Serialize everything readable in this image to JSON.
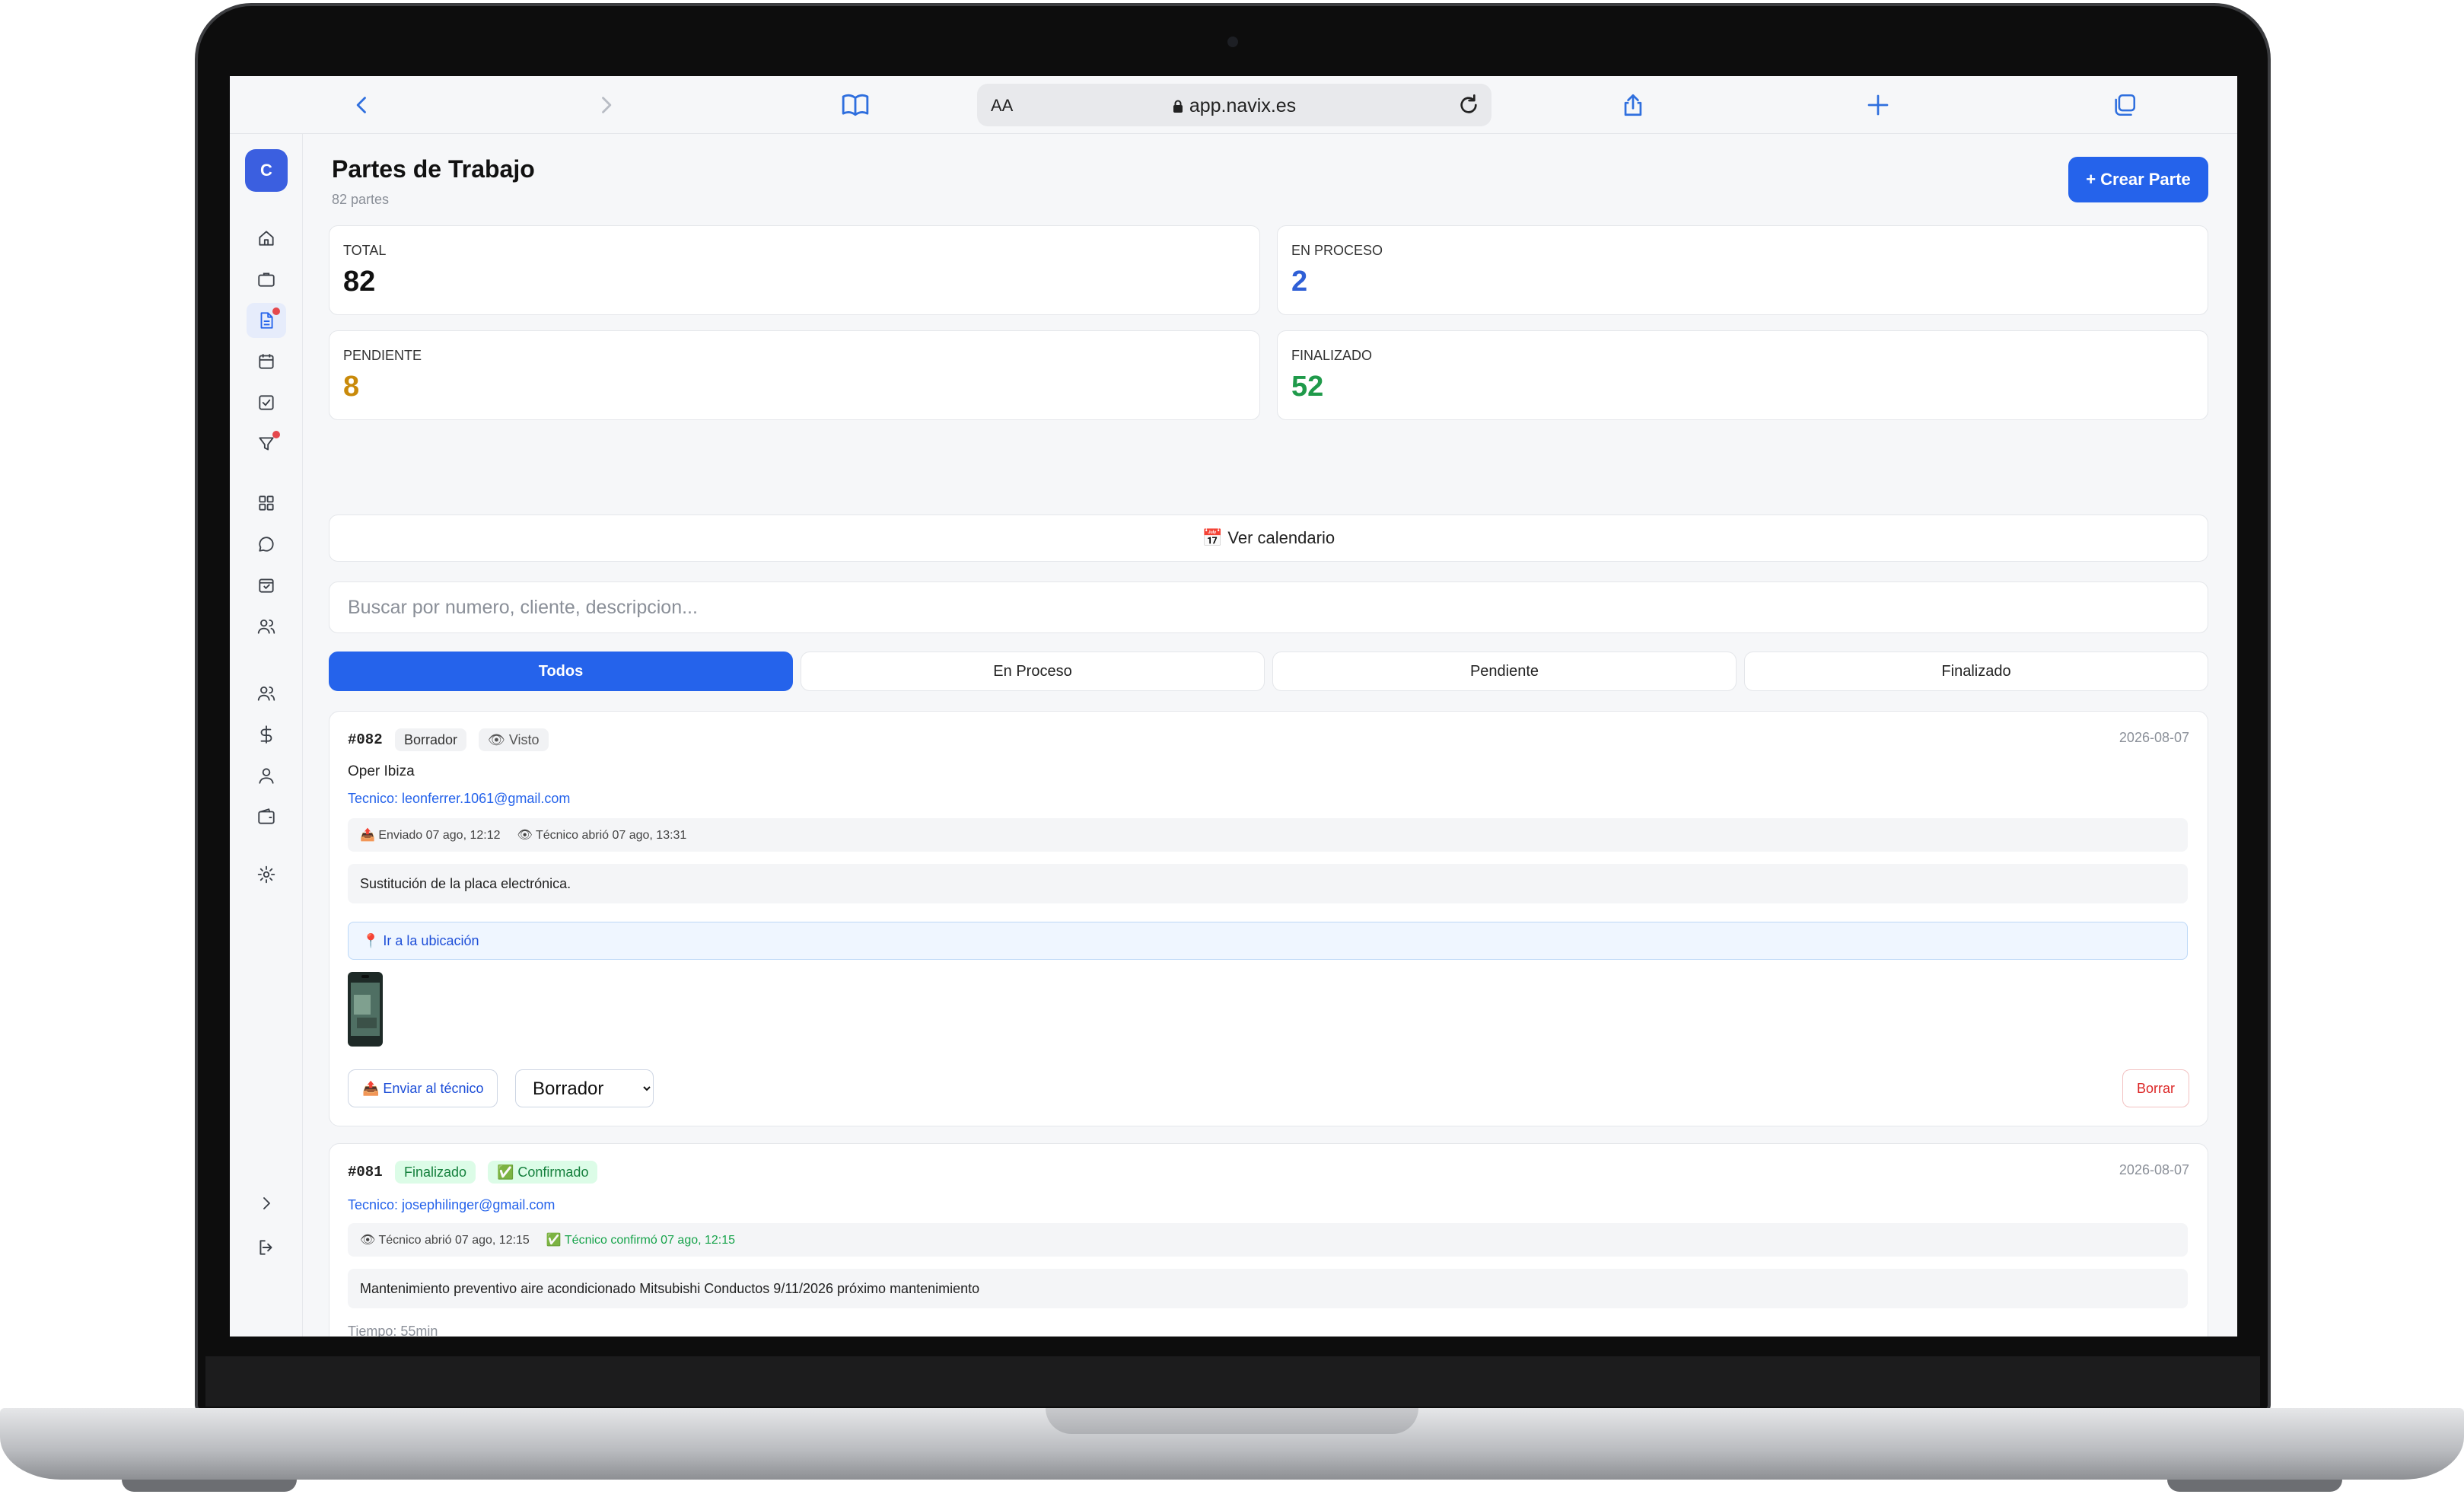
{
  "browser": {
    "aa_label": "AA",
    "url": "app.navix.es"
  },
  "sidebar": {
    "avatar_initial": "C"
  },
  "header": {
    "title": "Partes de Trabajo",
    "subtitle": "82 partes",
    "create_button": "+ Crear Parte"
  },
  "stats": [
    {
      "label": "TOTAL",
      "value": "82",
      "color": "#111111"
    },
    {
      "label": "EN PROCESO",
      "value": "2",
      "color": "#2f5fd6"
    },
    {
      "label": "PENDIENTE",
      "value": "8",
      "color": "#c98a0a"
    },
    {
      "label": "FINALIZADO",
      "value": "52",
      "color": "#1f9a4a"
    }
  ],
  "calendar_button": "📅 Ver calendario",
  "search": {
    "placeholder": "Buscar por numero, cliente, descripcion..."
  },
  "tabs": [
    "Todos",
    "En Proceso",
    "Pendiente",
    "Finalizado"
  ],
  "cards": [
    {
      "number": "#082",
      "status_badge": "Borrador",
      "seen_badge": "👁 Visto",
      "date": "2026-08-07",
      "client": "Oper Ibiza",
      "technician": "Tecnico: leonferrer.1061@gmail.com",
      "log_sent": "📤 Enviado 07 ago, 12:12",
      "log_opened": "👁 Técnico abrió 07 ago, 13:31",
      "description": "Sustitución de la placa electrónica.",
      "location": "📍 Ir a la ubicación",
      "send_button": "📤 Enviar al técnico",
      "status_value": "Borrador",
      "delete_button": "Borrar"
    },
    {
      "number": "#081",
      "status_badge": "Finalizado",
      "confirmed_badge": "✅ Confirmado",
      "date": "2026-08-07",
      "technician": "Tecnico: josephilinger@gmail.com",
      "log_opened": "👁 Técnico abrió 07 ago, 12:15",
      "log_confirmed": "✅ Técnico confirmó 07 ago, 12:15",
      "description": "Mantenimiento preventivo aire acondicionado Mitsubishi Conductos 9/11/2026 próximo mantenimiento",
      "time": "Tiempo: 55min"
    }
  ],
  "colors": {
    "accent": "#2563eb",
    "danger": "#dc2626",
    "success": "#16a34a"
  }
}
